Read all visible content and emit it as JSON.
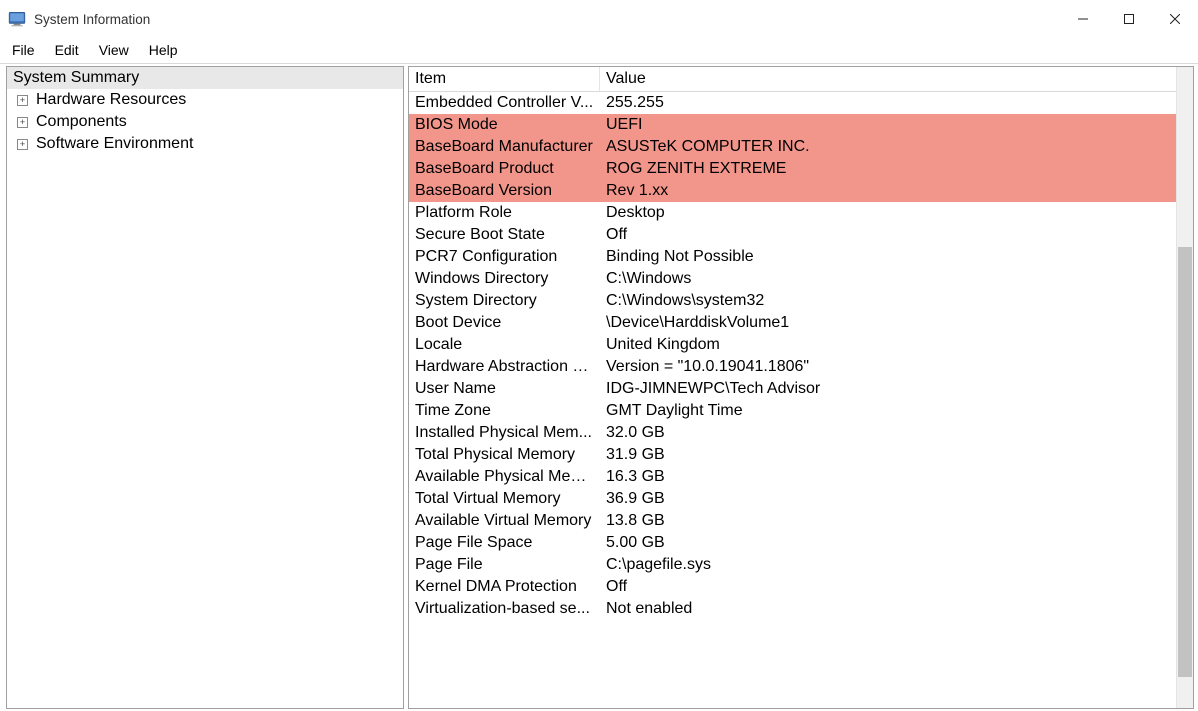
{
  "window": {
    "title": "System Information"
  },
  "menu": {
    "items": [
      "File",
      "Edit",
      "View",
      "Help"
    ]
  },
  "tree": {
    "root": "System Summary",
    "children": [
      "Hardware Resources",
      "Components",
      "Software Environment"
    ]
  },
  "detail": {
    "columns": [
      "Item",
      "Value"
    ],
    "rows": [
      {
        "item": "Embedded Controller V...",
        "value": "255.255",
        "highlight": false
      },
      {
        "item": "BIOS Mode",
        "value": "UEFI",
        "highlight": true
      },
      {
        "item": "BaseBoard Manufacturer",
        "value": "ASUSTeK COMPUTER INC.",
        "highlight": true
      },
      {
        "item": "BaseBoard Product",
        "value": "ROG ZENITH EXTREME",
        "highlight": true
      },
      {
        "item": "BaseBoard Version",
        "value": "Rev 1.xx",
        "highlight": true
      },
      {
        "item": "Platform Role",
        "value": "Desktop",
        "highlight": false
      },
      {
        "item": "Secure Boot State",
        "value": "Off",
        "highlight": false
      },
      {
        "item": "PCR7 Configuration",
        "value": "Binding Not Possible",
        "highlight": false
      },
      {
        "item": "Windows Directory",
        "value": "C:\\Windows",
        "highlight": false
      },
      {
        "item": "System Directory",
        "value": "C:\\Windows\\system32",
        "highlight": false
      },
      {
        "item": "Boot Device",
        "value": "\\Device\\HarddiskVolume1",
        "highlight": false
      },
      {
        "item": "Locale",
        "value": "United Kingdom",
        "highlight": false
      },
      {
        "item": "Hardware Abstraction L...",
        "value": "Version = \"10.0.19041.1806\"",
        "highlight": false
      },
      {
        "item": "User Name",
        "value": "IDG-JIMNEWPC\\Tech Advisor",
        "highlight": false
      },
      {
        "item": "Time Zone",
        "value": "GMT Daylight Time",
        "highlight": false
      },
      {
        "item": "Installed Physical Mem...",
        "value": "32.0 GB",
        "highlight": false
      },
      {
        "item": "Total Physical Memory",
        "value": "31.9 GB",
        "highlight": false
      },
      {
        "item": "Available Physical Mem...",
        "value": "16.3 GB",
        "highlight": false
      },
      {
        "item": "Total Virtual Memory",
        "value": "36.9 GB",
        "highlight": false
      },
      {
        "item": "Available Virtual Memory",
        "value": "13.8 GB",
        "highlight": false
      },
      {
        "item": "Page File Space",
        "value": "5.00 GB",
        "highlight": false
      },
      {
        "item": "Page File",
        "value": "C:\\pagefile.sys",
        "highlight": false
      },
      {
        "item": "Kernel DMA Protection",
        "value": "Off",
        "highlight": false
      },
      {
        "item": "Virtualization-based se...",
        "value": "Not enabled",
        "highlight": false
      }
    ]
  },
  "colors": {
    "highlight": "#f2968b"
  }
}
